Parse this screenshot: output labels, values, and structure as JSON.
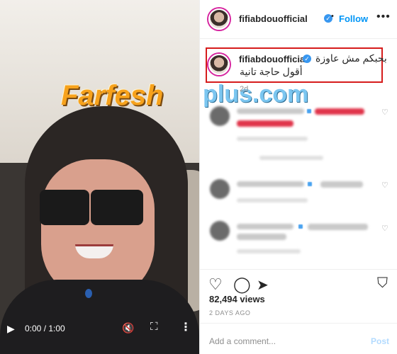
{
  "header": {
    "username": "fifiabdouofficial",
    "follow_label": "Follow",
    "more_icon": "more-icon"
  },
  "caption": {
    "username": "fifiabdouofficial",
    "text_line1": "بحبكم مش عاوزة",
    "text_line2": "أقول حاجة تانية",
    "time": "2d"
  },
  "watermark": {
    "brand": "Farfesh",
    "suffix": "plus.com"
  },
  "video": {
    "time": "0:00 / 1:00",
    "progress_percent": 0
  },
  "actions": {
    "views": "82,494 views",
    "posted": "2 DAYS AGO"
  },
  "comment_box": {
    "placeholder": "Add a comment...",
    "post_label": "Post"
  },
  "colors": {
    "accent": "#0095f6",
    "caption_border": "#d61c1c",
    "verified": "#3897f0"
  }
}
